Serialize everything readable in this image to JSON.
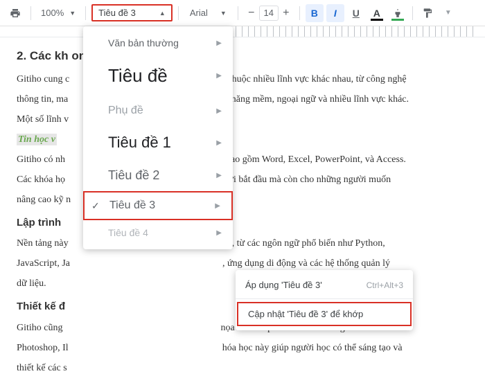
{
  "toolbar": {
    "zoom": "100%",
    "style_label": "Tiêu đề 3",
    "font_label": "Arial",
    "font_size": "14",
    "bold": "B",
    "italic": "I",
    "underline": "U",
    "textcolor": "A"
  },
  "styles_menu": {
    "normal": "Văn bản thường",
    "title": "Tiêu đề",
    "subtitle": "Phụ đề",
    "h1": "Tiêu đề 1",
    "h2": "Tiêu đề 2",
    "h3": "Tiêu đề 3",
    "h4": "Tiêu đề 4"
  },
  "submenu": {
    "apply": "Áp dụng 'Tiêu đề 3'",
    "apply_kbd": "Ctrl+Alt+3",
    "update": "Cập nhật 'Tiêu đề 3' để khớp"
  },
  "doc": {
    "sec2_title": "2. Các kh                                          ong phú",
    "p1a": "Gitiho cung c",
    "p1b": "n thuộc nhiều lĩnh vực khác nhau, từ công nghệ",
    "p2a": "thông tin, ma",
    "p2b": "ỹ năng mềm, ngoại ngữ và nhiều lĩnh vực khác.",
    "p3": "Một số lĩnh v",
    "hl": "Tin học v",
    "p4a": "Gitiho có nh",
    "p4b": ", bao gồm Word, Excel, PowerPoint, và Access.",
    "p5a": "Các khóa họ",
    "p5b": "ười bắt đầu mà còn cho những người muốn",
    "p6": "nâng cao kỹ n",
    "h3a": "Lập trình",
    "p7a": "Nền tảng này",
    "p7b": "nh, từ các ngôn ngữ phổ biến như Python,",
    "p8a": "JavaScript, Ja",
    "p8b": ", ứng dụng di động và các hệ thống quản lý",
    "p9": "dữ liệu.",
    "h3b": "Thiết kế đ",
    "p10a": "Gitiho cũng",
    "p10b": "nọa với các phần mềm nổi tiếng như Adobe",
    "p11a": "Photoshop, Il",
    "p11b": "hóa học này giúp người học có thể sáng tạo và",
    "p12": "thiết kế các s"
  }
}
